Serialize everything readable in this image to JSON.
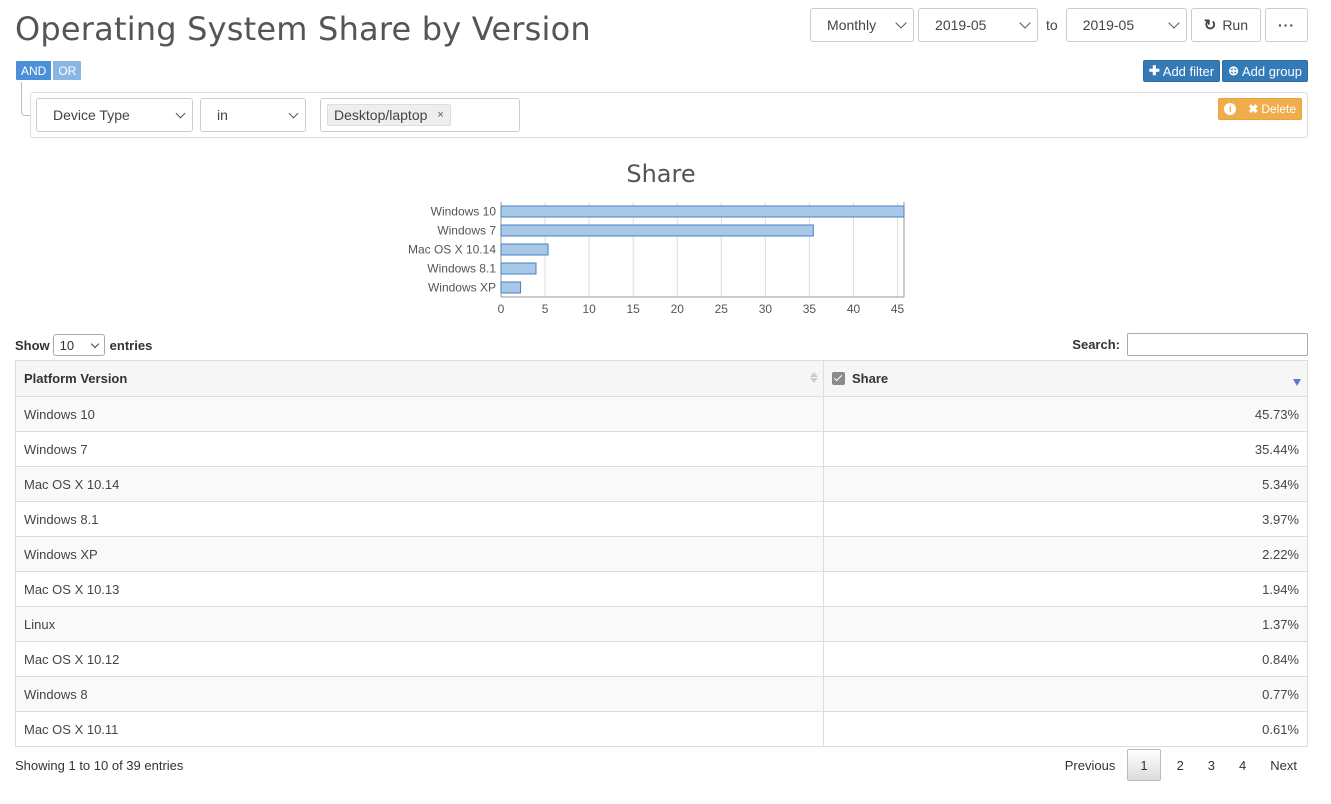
{
  "title": "Operating System Share by Version",
  "controls": {
    "period": "Monthly",
    "from": "2019-05",
    "to_label": "to",
    "to": "2019-05",
    "run_label": "Run",
    "more_label": "···"
  },
  "logic": {
    "and": "AND",
    "or": "OR"
  },
  "actions": {
    "add_filter": "Add filter",
    "add_group": "Add group",
    "delete": "Delete"
  },
  "rule": {
    "field": "Device Type",
    "operator": "in",
    "value": "Desktop/laptop",
    "remove": "×"
  },
  "chart_data": {
    "type": "bar",
    "orientation": "horizontal",
    "title": "Share",
    "categories": [
      "Windows 10",
      "Windows 7",
      "Mac OS X 10.14",
      "Windows 8.1",
      "Windows XP"
    ],
    "values": [
      45.73,
      35.44,
      5.34,
      3.97,
      2.22
    ],
    "xticks": [
      0,
      5,
      10,
      15,
      20,
      25,
      30,
      35,
      40,
      45
    ],
    "xlim": [
      0,
      45.73
    ],
    "grid": true,
    "bar_color": "#a8c8ea",
    "bar_stroke": "#4a7fbf"
  },
  "table": {
    "show_label": "Show",
    "entries_label": "entries",
    "page_length": "10",
    "search_label": "Search:",
    "columns": [
      "Platform Version",
      "Share"
    ],
    "rows": [
      [
        "Windows 10",
        "45.73%"
      ],
      [
        "Windows 7",
        "35.44%"
      ],
      [
        "Mac OS X 10.14",
        "5.34%"
      ],
      [
        "Windows 8.1",
        "3.97%"
      ],
      [
        "Windows XP",
        "2.22%"
      ],
      [
        "Mac OS X 10.13",
        "1.94%"
      ],
      [
        "Linux",
        "1.37%"
      ],
      [
        "Mac OS X 10.12",
        "0.84%"
      ],
      [
        "Windows 8",
        "0.77%"
      ],
      [
        "Mac OS X 10.11",
        "0.61%"
      ]
    ],
    "info": "Showing 1 to 10 of 39 entries"
  },
  "pagination": {
    "previous": "Previous",
    "pages": [
      "1",
      "2",
      "3",
      "4"
    ],
    "next": "Next"
  }
}
